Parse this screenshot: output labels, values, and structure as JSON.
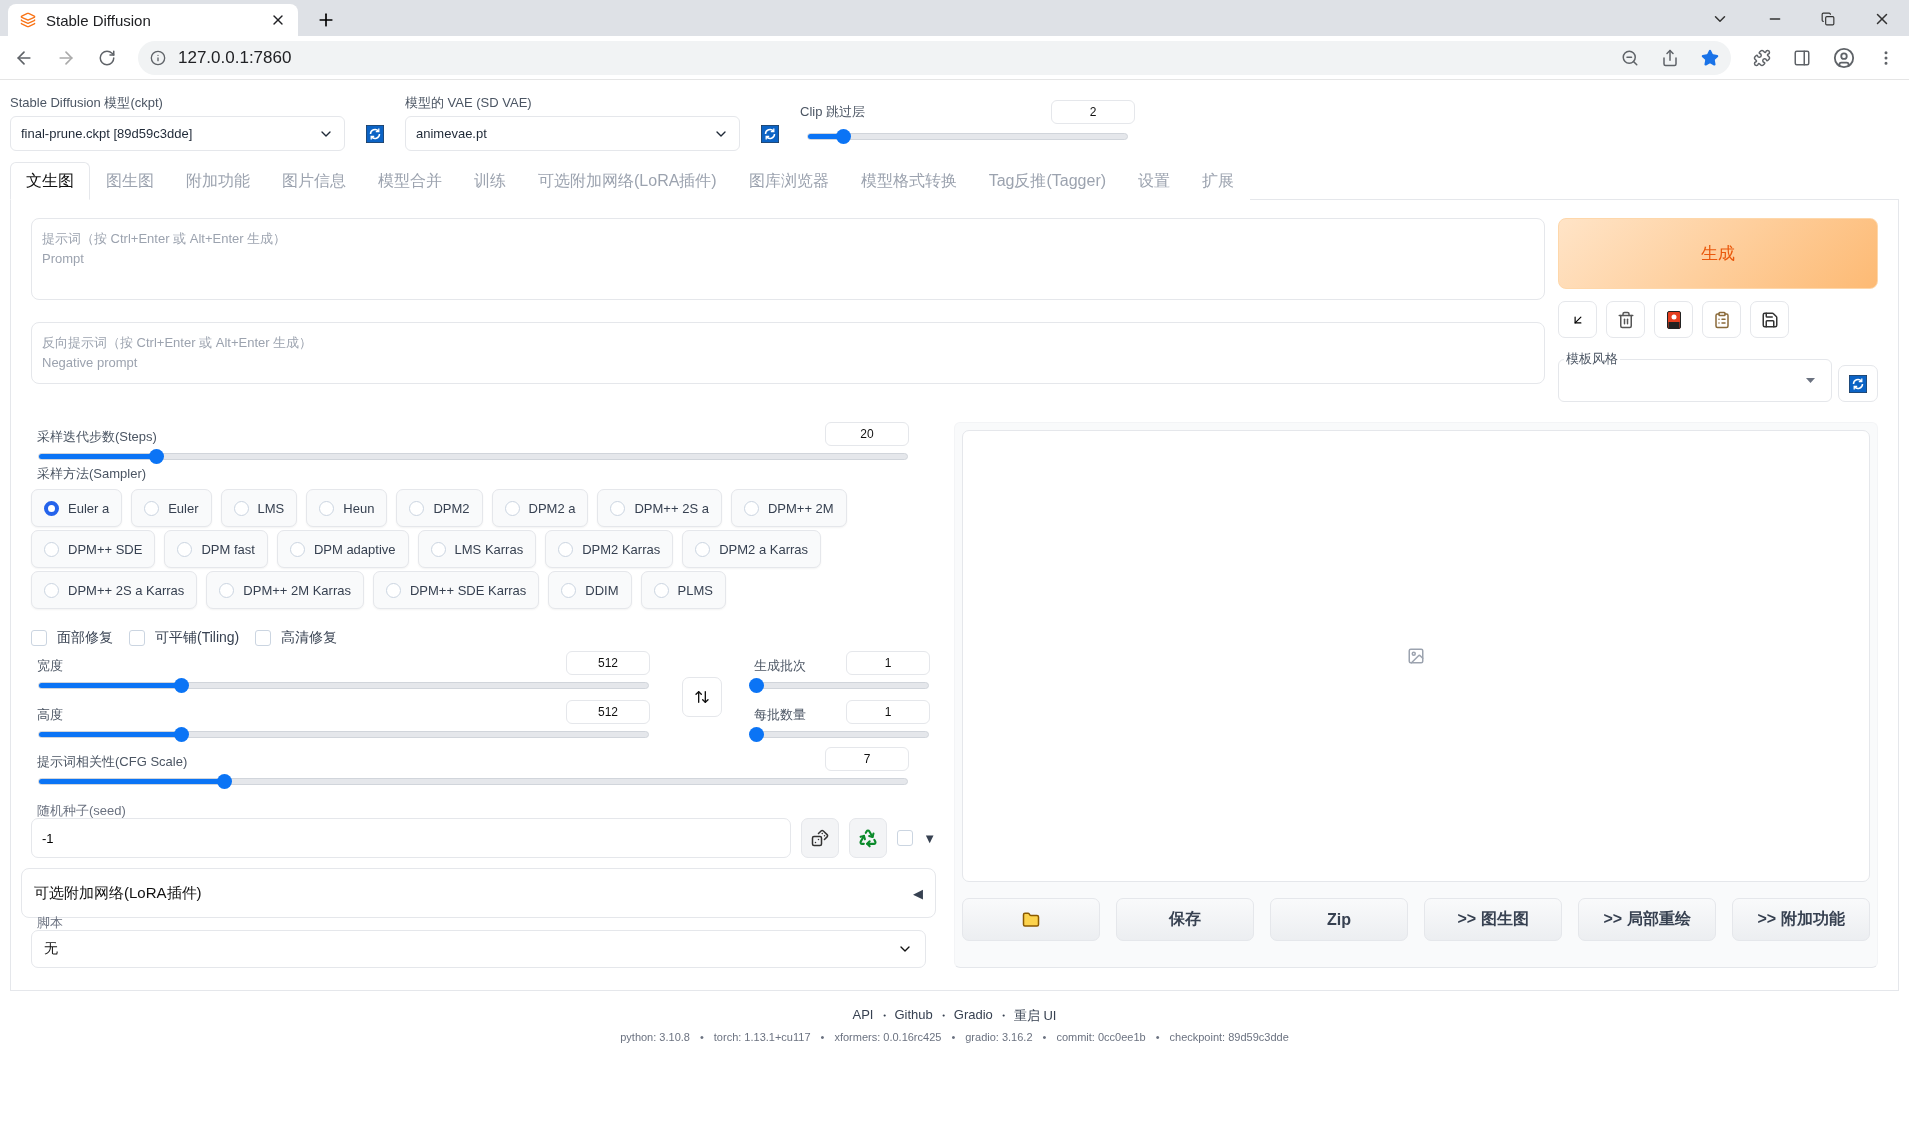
{
  "browser": {
    "tab_title": "Stable Diffusion",
    "url": "127.0.0.1:7860"
  },
  "settings": {
    "checkpoint": {
      "label": "Stable Diffusion 模型(ckpt)",
      "value": "final-prune.ckpt [89d59c3dde]"
    },
    "vae": {
      "label": "模型的 VAE (SD VAE)",
      "value": "animevae.pt"
    },
    "clip_skip": {
      "label": "Clip 跳过层",
      "value": "2",
      "level": 0.11
    }
  },
  "tabs": [
    {
      "label": "文生图",
      "selected": true
    },
    {
      "label": "图生图",
      "selected": false
    },
    {
      "label": "附加功能",
      "selected": false
    },
    {
      "label": "图片信息",
      "selected": false
    },
    {
      "label": "模型合并",
      "selected": false
    },
    {
      "label": "训练",
      "selected": false
    },
    {
      "label": "可选附加网络(LoRA插件)",
      "selected": false
    },
    {
      "label": "图库浏览器",
      "selected": false
    },
    {
      "label": "模型格式转换",
      "selected": false
    },
    {
      "label": "Tag反推(Tagger)",
      "selected": false
    },
    {
      "label": "设置",
      "selected": false
    },
    {
      "label": "扩展",
      "selected": false
    }
  ],
  "prompt": {
    "placeholder": "提示词（按 Ctrl+Enter 或 Alt+Enter 生成）\nPrompt"
  },
  "negative_prompt": {
    "placeholder": "反向提示词（按 Ctrl+Enter 或 Alt+Enter 生成）\nNegative prompt"
  },
  "generate": "生成",
  "style": {
    "label": "模板风格"
  },
  "steps": {
    "label": "采样迭代步数(Steps)",
    "value": "20",
    "level": 0.135
  },
  "sampler": {
    "label": "采样方法(Sampler)",
    "options": [
      {
        "label": "Euler a",
        "selected": true
      },
      {
        "label": "Euler",
        "selected": false
      },
      {
        "label": "LMS",
        "selected": false
      },
      {
        "label": "Heun",
        "selected": false
      },
      {
        "label": "DPM2",
        "selected": false
      },
      {
        "label": "DPM2 a",
        "selected": false
      },
      {
        "label": "DPM++ 2S a",
        "selected": false
      },
      {
        "label": "DPM++ 2M",
        "selected": false
      },
      {
        "label": "DPM++ SDE",
        "selected": false
      },
      {
        "label": "DPM fast",
        "selected": false
      },
      {
        "label": "DPM adaptive",
        "selected": false
      },
      {
        "label": "LMS Karras",
        "selected": false
      },
      {
        "label": "DPM2 Karras",
        "selected": false
      },
      {
        "label": "DPM2 a Karras",
        "selected": false
      },
      {
        "label": "DPM++ 2S a Karras",
        "selected": false
      },
      {
        "label": "DPM++ 2M Karras",
        "selected": false
      },
      {
        "label": "DPM++ SDE Karras",
        "selected": false
      },
      {
        "label": "DDIM",
        "selected": false
      },
      {
        "label": "PLMS",
        "selected": false
      }
    ]
  },
  "options": [
    {
      "label": "面部修复",
      "checked": false
    },
    {
      "label": "可平铺(Tiling)",
      "checked": false
    },
    {
      "label": "高清修复",
      "checked": false
    }
  ],
  "width": {
    "label": "宽度",
    "value": "512",
    "level": 0.233
  },
  "height": {
    "label": "高度",
    "value": "512",
    "level": 0.233
  },
  "batch_count": {
    "label": "生成批次",
    "value": "1",
    "level": 0
  },
  "batch_size": {
    "label": "每批数量",
    "value": "1",
    "level": 0
  },
  "cfg": {
    "label": "提示词相关性(CFG Scale)",
    "value": "7",
    "level": 0.213
  },
  "seed": {
    "label": "随机种子(seed)",
    "value": "-1",
    "extra_checked": false,
    "caret": "▼"
  },
  "lora": {
    "title": "可选附加网络(LoRA插件)",
    "toggle": "◀"
  },
  "script": {
    "label": "脚本",
    "value": "无"
  },
  "output_buttons": [
    {
      "kind": "folder"
    },
    {
      "kind": "text",
      "label": "保存"
    },
    {
      "kind": "text",
      "label": "Zip"
    },
    {
      "kind": "text",
      "label": ">> 图生图"
    },
    {
      "kind": "text",
      "label": ">> 局部重绘"
    },
    {
      "kind": "text",
      "label": ">> 附加功能"
    }
  ],
  "footer": {
    "links": [
      "API",
      "Github",
      "Gradio",
      "重启 UI"
    ],
    "link_separator": "・",
    "versions": [
      "python: 3.10.8",
      "torch: 1.13.1+cu117",
      "xformers: 0.0.16rc425",
      "gradio: 3.16.2",
      "commit: 0cc0ee1b",
      "checkpoint: 89d59c3dde"
    ],
    "version_separator": "•"
  }
}
